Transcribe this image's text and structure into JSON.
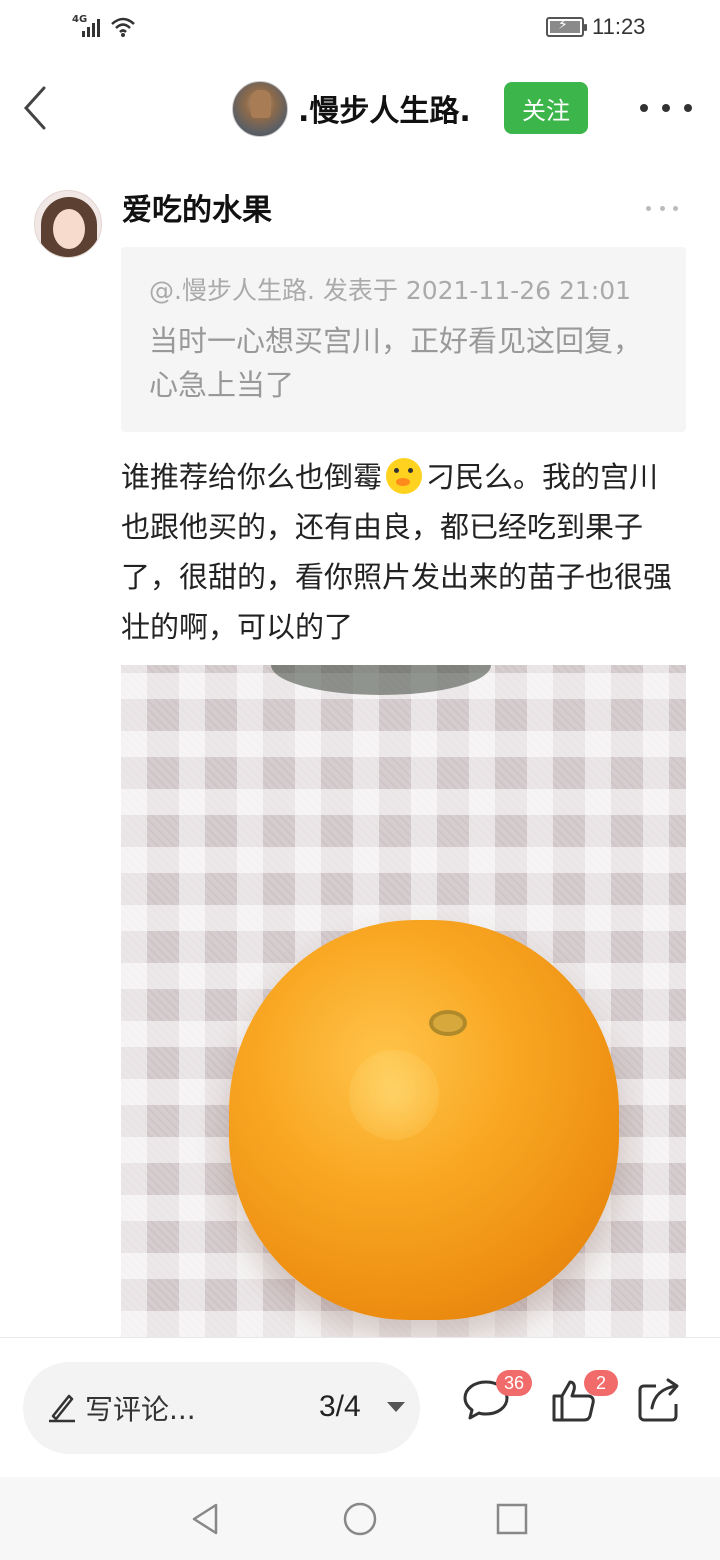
{
  "status_bar": {
    "network": "4G",
    "time": "11:23"
  },
  "header": {
    "author_name": ".慢步人生路.",
    "follow_label": "关注"
  },
  "post": {
    "title": "爱吃的水果",
    "quote": {
      "meta": "@.慢步人生路. 发表于 2021-11-26 21:01",
      "text": "当时一心想买宫川，正好看见这回复，心急上当了"
    },
    "body_before_emoji": "谁推荐给你么也倒霉",
    "body_after_emoji": "刁民么。我的宫川也跟他买的，还有由良，都已经吃到果子了，很甜的，看你照片发出来的苗子也很强壮的啊，可以的了"
  },
  "bottom_bar": {
    "comment_placeholder": "写评论...",
    "page_indicator": "3/4",
    "comment_count": "36",
    "like_count": "2"
  },
  "icons": {
    "back": "chevron-left-icon",
    "more": "more-horizontal-icon",
    "edit": "pen-icon",
    "comment": "comment-bubble-icon",
    "like": "thumbs-up-icon",
    "share": "share-icon",
    "nav_back": "triangle-back-icon",
    "nav_home": "circle-home-icon",
    "nav_recent": "square-recent-icon"
  },
  "colors": {
    "follow_button": "#3cb54a",
    "badge": "#f26b6b"
  }
}
